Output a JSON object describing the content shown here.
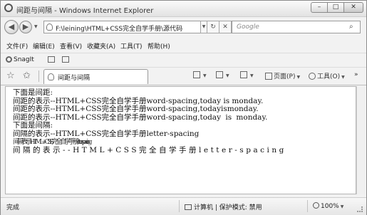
{
  "window": {
    "title": "间距与间隔 - Windows Internet Explorer",
    "controls": {
      "minimize": "–",
      "maximize": "□",
      "close": "✕"
    }
  },
  "address": {
    "back_icon": "back-arrow-icon",
    "forward_icon": "forward-arrow-icon",
    "url": "F:\\leining\\HTML+CSS完全自学手册\\源代码",
    "refresh": "↻",
    "stop": "✕",
    "search_placeholder": "Google",
    "search_glyph": "⌕"
  },
  "menu": {
    "items": [
      "文件(F)",
      "编辑(E)",
      "查看(V)",
      "收藏夹(A)",
      "工具(T)",
      "帮助(H)"
    ]
  },
  "favbar": {
    "snagit_label": "SnagIt"
  },
  "tabbar": {
    "tab_label": "间距与间隔",
    "commands": {
      "page": "页面(P)",
      "tools": "工具(O)"
    }
  },
  "content": {
    "lines": [
      "下面是间距:",
      "间距的表示--HTML+CSS完全自学手册word-spacing,today is monday.",
      "间距的表示--HTML+CSS完全自学手册word-spacing,todayismonday.",
      "间距的表示--HTML+CSS完全自学手册word-spacing,today  is  monday.",
      "下面是间隔:",
      "间隔的表示--HTML+CSS完全自学手册letter-spacing",
      "间隔表示--HTML+CSS完全自学手册letter-spacing",
      "间隔的表示--HTML+CSS完全自学手册letter-spacing"
    ]
  },
  "status": {
    "text": "完成",
    "zone": "计算机 | 保护模式: 禁用",
    "zoom": "100%"
  }
}
